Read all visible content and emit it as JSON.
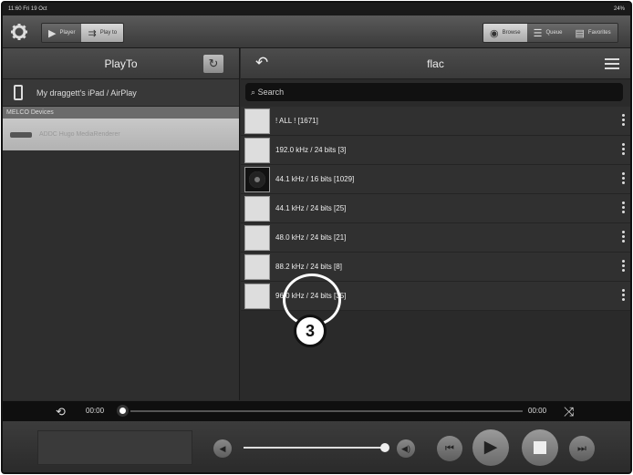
{
  "status": {
    "time": "11:60",
    "date": "Fri 19 Oct",
    "battery": "24%"
  },
  "toolbar": {
    "player_label": "Player",
    "playto_label": "Play to",
    "browse_label": "Browse",
    "queue_label": "Queue",
    "favorites_label": "Favorites"
  },
  "left": {
    "title": "PlayTo",
    "airplay_device": "My draggett's iPad / AirPlay",
    "section": "MELCO Devices",
    "selected_device": "ADDC Hugo MediaRenderer"
  },
  "right": {
    "title": "flac",
    "search_placeholder": "Search",
    "items": [
      {
        "label": "! ALL ! [1671]",
        "thumb": "light"
      },
      {
        "label": "192.0 kHz / 24 bits [3]",
        "thumb": "light"
      },
      {
        "label": "44.1 kHz / 16 bits [1029]",
        "thumb": "dark"
      },
      {
        "label": "44.1 kHz / 24 bits [25]",
        "thumb": "light"
      },
      {
        "label": "48.0 kHz / 24 bits [21]",
        "thumb": "light"
      },
      {
        "label": "88.2 kHz / 24 bits [8]",
        "thumb": "light"
      },
      {
        "label": "96.0 kHz / 24 bits [35]",
        "thumb": "light"
      }
    ]
  },
  "callout": {
    "number": "3"
  },
  "player": {
    "elapsed": "00:00",
    "total": "00:00"
  },
  "icons": {
    "settings": "gear-icon",
    "back": "back-arrow-icon",
    "repeat": "repeat-icon",
    "shuffle": "shuffle-icon"
  }
}
